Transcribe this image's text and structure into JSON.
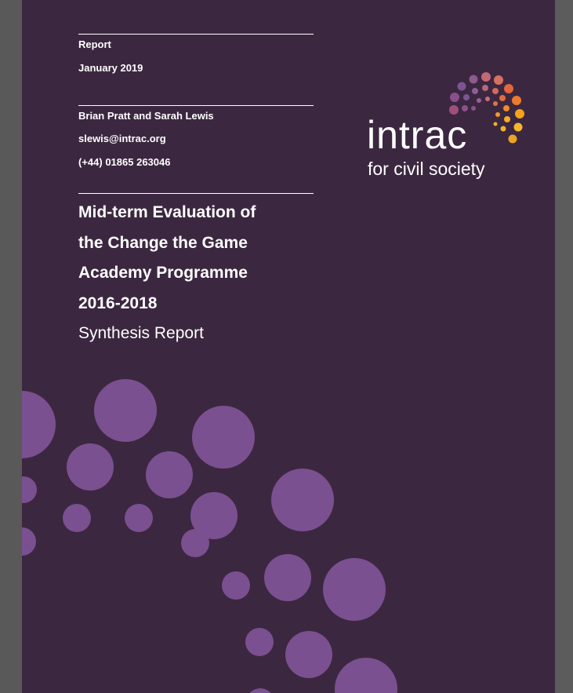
{
  "document": {
    "report_label": "Report",
    "date": "January 2019",
    "authors": "Brian Pratt and Sarah Lewis",
    "email": "slewis@intrac.org",
    "phone": "(+44) 01865 263046",
    "title_lines": [
      "Mid-term Evaluation of",
      "the Change the Game",
      "Academy Programme",
      "2016-2018"
    ],
    "subtitle": "Synthesis Report"
  },
  "logo": {
    "wordmark": "intrac",
    "tagline": "for civil society"
  },
  "colors": {
    "page_background": "#3c2740",
    "bubble": "#7a5090",
    "viewer_background": "#595959"
  }
}
